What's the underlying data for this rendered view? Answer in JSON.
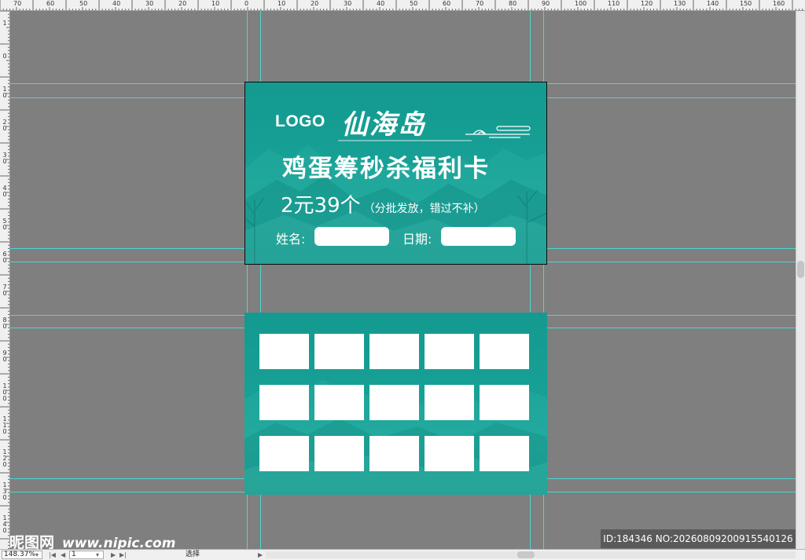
{
  "ruler": {
    "top_labels": [
      "70",
      "60",
      "50",
      "40",
      "30",
      "20",
      "10",
      "0",
      "10",
      "20",
      "30",
      "40",
      "50",
      "60",
      "70",
      "80",
      "90",
      "100",
      "110",
      "120",
      "130",
      "140",
      "150",
      "160"
    ],
    "left_labels": [
      "1",
      "0",
      "1\n0",
      "2\n0",
      "3\n0",
      "4\n0",
      "5\n0",
      "6\n0",
      "7\n0",
      "8\n0",
      "9\n0",
      "1\n0\n0",
      "1\n1\n0",
      "1\n2\n0",
      "1\n3\n0",
      "1\n4\n0"
    ]
  },
  "front_card": {
    "logo": "LOGO",
    "brand": "仙海岛",
    "title": "鸡蛋筹秒杀福利卡",
    "price": "2元39个",
    "price_note": "（分批发放，错过不补）",
    "name_label": "姓名:",
    "date_label": "日期:"
  },
  "back_card": {
    "stamp_rows": 3,
    "stamp_cols": 5
  },
  "statusbar": {
    "zoom": "148.37%",
    "page": "1",
    "tool": "选择"
  },
  "watermark": {
    "site_name": "昵图网",
    "site_url": "www.nipic.com",
    "id_text": "ID:184346 NO:20260809200915540126"
  },
  "colors": {
    "card_teal": "#17a095",
    "guide": "#3ee8e0",
    "canvas": "#7f7f7f"
  }
}
